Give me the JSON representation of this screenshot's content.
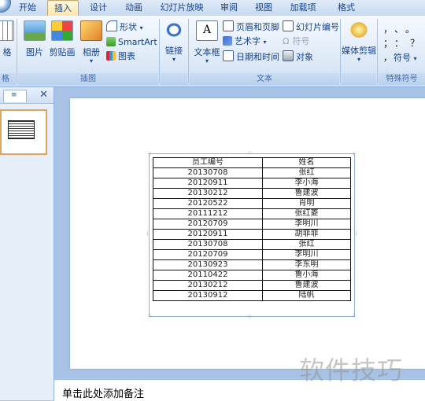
{
  "tabs": [
    {
      "label": "开始",
      "active": false
    },
    {
      "label": "插入",
      "active": true
    },
    {
      "label": "设计",
      "active": false
    },
    {
      "label": "动画",
      "active": false
    },
    {
      "label": "幻灯片放映",
      "active": false
    },
    {
      "label": "审阅",
      "active": false
    },
    {
      "label": "视图",
      "active": false
    },
    {
      "label": "加载项",
      "active": false
    },
    {
      "label": "格式",
      "active": false
    }
  ],
  "ribbon": {
    "table_group": {
      "title": "格",
      "button": "格"
    },
    "illustrations": {
      "title": "插图",
      "picture": "图片",
      "clipart": "剪贴画",
      "album": "相册",
      "shapes": "形状",
      "smartart": "SmartArt",
      "chart": "图表"
    },
    "links": {
      "button": "链接"
    },
    "text": {
      "title": "文本",
      "textbox": "文本框",
      "header_footer": "页眉和页脚",
      "wordart": "艺术字",
      "datetime": "日期和时间",
      "slide_number": "幻灯片编号",
      "symbol": "符号",
      "object": "对象"
    },
    "media": {
      "button": "媒体剪辑"
    },
    "special": {
      "title": "特殊符号",
      "symbol": "符号",
      "chars": [
        "，",
        "、",
        "。",
        "；",
        "：",
        "？",
        "，"
      ]
    }
  },
  "slide_table": {
    "headers": [
      "员工编号",
      "姓名"
    ],
    "rows": [
      [
        "20130708",
        "张红"
      ],
      [
        "20120911",
        "李小海"
      ],
      [
        "20130212",
        "鲁建波"
      ],
      [
        "20120522",
        "肖明"
      ],
      [
        "20111212",
        "张红菱"
      ],
      [
        "20120709",
        "李明川"
      ],
      [
        "20120911",
        "胡菲菲"
      ],
      [
        "20130708",
        "张红"
      ],
      [
        "20120709",
        "李明川"
      ],
      [
        "20130923",
        "李东明"
      ],
      [
        "20110422",
        "鲁小海"
      ],
      [
        "20130212",
        "鲁建波"
      ],
      [
        "20130912",
        "陆帆"
      ]
    ]
  },
  "notes": {
    "placeholder": "单击此处添加备注"
  },
  "watermark": "软件技巧"
}
